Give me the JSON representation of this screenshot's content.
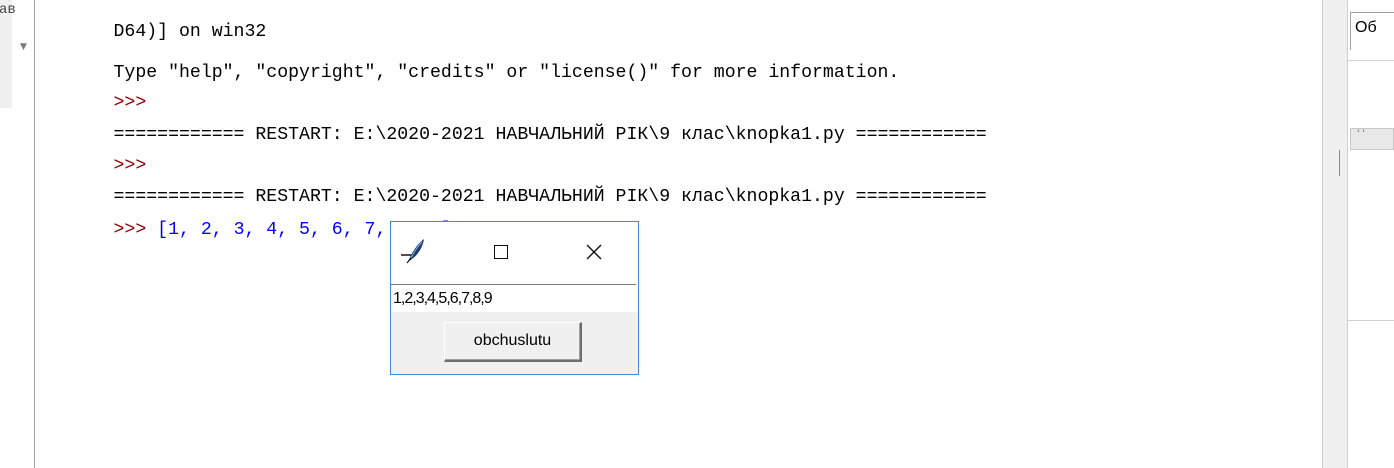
{
  "left_gutter": {
    "fragment": "ав",
    "fold_icon": "chevron-down-icon"
  },
  "shell": {
    "lines": [
      {
        "kind": "plain",
        "text": "D64)] on win32"
      },
      {
        "kind": "plain",
        "text": "Type \"help\", \"copyright\", \"credits\" or \"license()\" for more information."
      },
      {
        "kind": "prompt",
        "prompt": ">>>",
        "text": ""
      },
      {
        "kind": "plain",
        "text": "============ RESTART: E:\\2020-2021 НАВЧАЛЬНИЙ РІК\\9 клас\\knopka1.py ============"
      },
      {
        "kind": "prompt",
        "prompt": ">>>",
        "text": ""
      },
      {
        "kind": "plain",
        "text": "============ RESTART: E:\\2020-2021 НАВЧАЛЬНИЙ РІК\\9 клас\\knopka1.py ============"
      },
      {
        "kind": "prompt",
        "prompt": ">>>",
        "text": " [1, 2, 3, 4, 5, 6, 7, 8, 9]"
      }
    ],
    "colors": {
      "prompt": "#8b0000",
      "output": "#0000ff",
      "text": "#000000"
    }
  },
  "right_panel": {
    "tab_text": "Об",
    "box_text": "' '"
  },
  "tk_window": {
    "title_icon": "tk-feather-icon",
    "maximize_icon": "maximize-icon",
    "close_icon": "close-icon",
    "entry_value": "1,2,3,4,5,6,7,8,9",
    "button_label": "obchuslutu",
    "border_color": "#3c8edc"
  }
}
